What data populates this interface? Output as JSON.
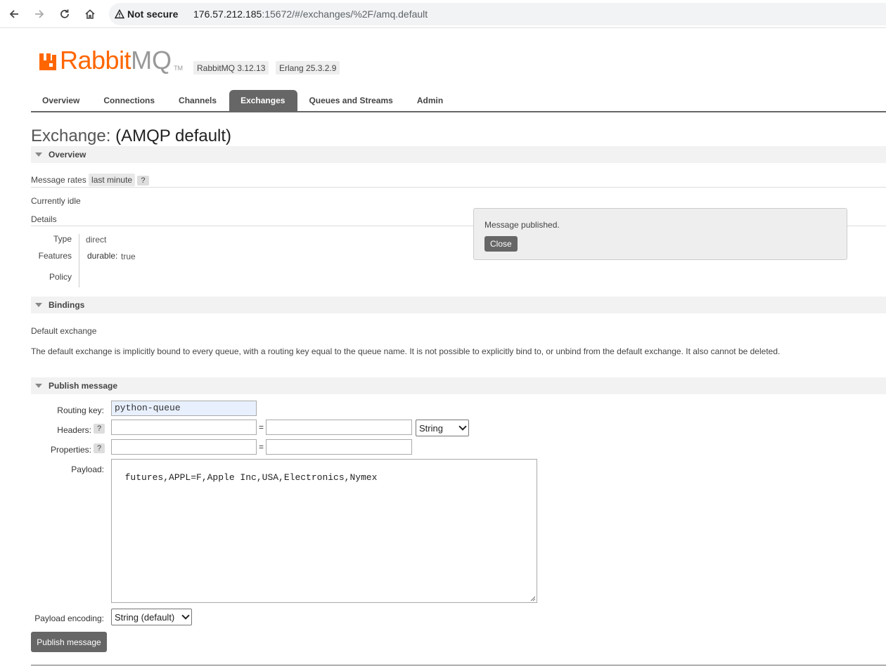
{
  "browser": {
    "security": "Not secure",
    "url_host": "176.57.212.185",
    "url_rest": ":15672/#/exchanges/%2F/amq.default"
  },
  "header": {
    "logo_word": "Rabbit",
    "logo_mq": "MQ",
    "logo_tm": "TM",
    "version": "RabbitMQ 3.12.13",
    "erlang": "Erlang 25.3.2.9"
  },
  "tabs": [
    {
      "label": "Overview",
      "active": false
    },
    {
      "label": "Connections",
      "active": false
    },
    {
      "label": "Channels",
      "active": false
    },
    {
      "label": "Exchanges",
      "active": true
    },
    {
      "label": "Queues and Streams",
      "active": false
    },
    {
      "label": "Admin",
      "active": false
    }
  ],
  "page": {
    "title_kind": "Exchange:",
    "title_name": "(AMQP default)"
  },
  "overview": {
    "section": "Overview",
    "message_rates": "Message rates",
    "rate_period": "last minute",
    "help": "?",
    "status": "Currently idle",
    "details": "Details",
    "type_key": "Type",
    "type_val": "direct",
    "features_key": "Features",
    "features_durable_key": "durable:",
    "features_durable_val": "true",
    "policy_key": "Policy"
  },
  "popup": {
    "message": "Message published.",
    "close": "Close"
  },
  "bindings": {
    "section": "Bindings",
    "label": "Default exchange",
    "text": "The default exchange is implicitly bound to every queue, with a routing key equal to the queue name. It is not possible to explicitly bind to, or unbind from the default exchange. It also cannot be deleted."
  },
  "publish": {
    "section": "Publish message",
    "routing_key_label": "Routing key:",
    "routing_key_value": "python-queue",
    "headers_label": "Headers:",
    "headers_type": "String",
    "properties_label": "Properties:",
    "help": "?",
    "eq": "=",
    "payload_label": "Payload:",
    "payload_value": "futures,APPL=F,Apple Inc,USA,Electronics,Nymex",
    "encoding_label": "Payload encoding:",
    "encoding_value": "String (default)",
    "button": "Publish message"
  }
}
